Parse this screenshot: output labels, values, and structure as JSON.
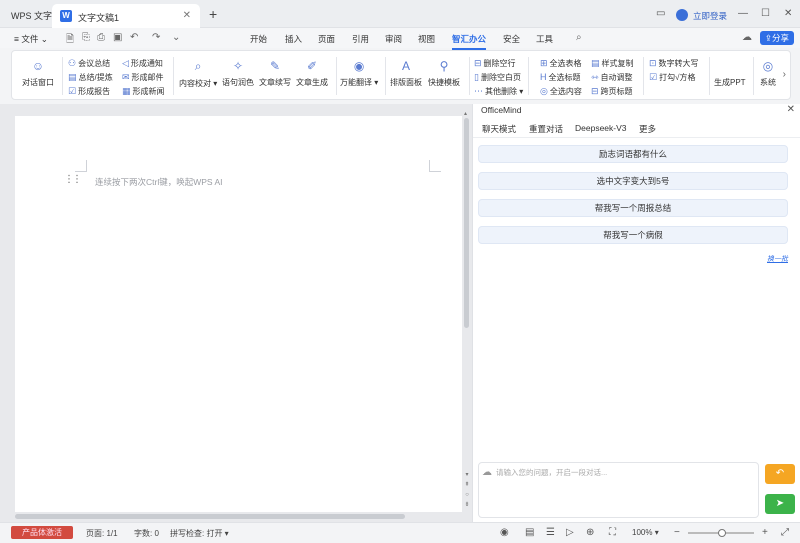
{
  "titlebar": {
    "app_name": "WPS 文字",
    "doc_tab_label": "文字文稿1",
    "doc_icon_letter": "W",
    "login_label": "立即登录"
  },
  "menu": {
    "file_label": "文件",
    "tabs": [
      "开始",
      "插入",
      "页面",
      "引用",
      "审阅",
      "视图",
      "智汇办公",
      "安全",
      "工具"
    ],
    "active_tab": "智汇办公",
    "share_label": "分享"
  },
  "ribbon": {
    "chat_window": "对话窗口",
    "meeting_summary": "会议总结",
    "summary_extract": "总结/提炼",
    "form_report": "形成报告",
    "form_notice": "形成通知",
    "form_email": "形成邮件",
    "form_news": "形成新闻",
    "content_check": "内容校对",
    "sentence_polish": "语句润色",
    "article_continue": "文章续写",
    "article_generate": "文章生成",
    "smart_translate": "万能翻译",
    "layout_panel": "排版面板",
    "quick_template": "快捷模板",
    "delete_empty_lines": "删除空行",
    "delete_blank_pages": "删除空白页",
    "other_delete": "其他删除",
    "select_all_tables": "全选表格",
    "select_all_titles": "全选标题",
    "select_all_content": "全选内容",
    "style_copy": "样式复制",
    "auto_adjust": "自动调整",
    "cross_page_title": "跨页标题",
    "number_to_upper": "数字转大写",
    "tick_box": "打勾√方格",
    "generate_ppt": "生成PPT",
    "system": "系统"
  },
  "document": {
    "hint": "连续按下两次Ctrl键，唤起WPS AI"
  },
  "panel": {
    "title": "OfficeMind",
    "tabs": [
      "聊天模式",
      "重置对话",
      "Deepseek-V3",
      "更多"
    ],
    "suggestions": [
      "励志词语都有什么",
      "选中文字变大到5号",
      "帮我写一个周报总结",
      "帮我写一个病假"
    ],
    "change_batch": "换一批",
    "input_placeholder": "请输入您的问题，开启一段对话..."
  },
  "status": {
    "activate_label": "产品体激活",
    "page": "页面: 1/1",
    "words": "字数: 0",
    "spell_check": "拼写检查: 打开",
    "zoom": "100%"
  },
  "colors": {
    "accent": "#2f6ee6",
    "activate_red": "#d24a3f",
    "send_green": "#3cb34a",
    "undo_orange": "#f5a623"
  }
}
